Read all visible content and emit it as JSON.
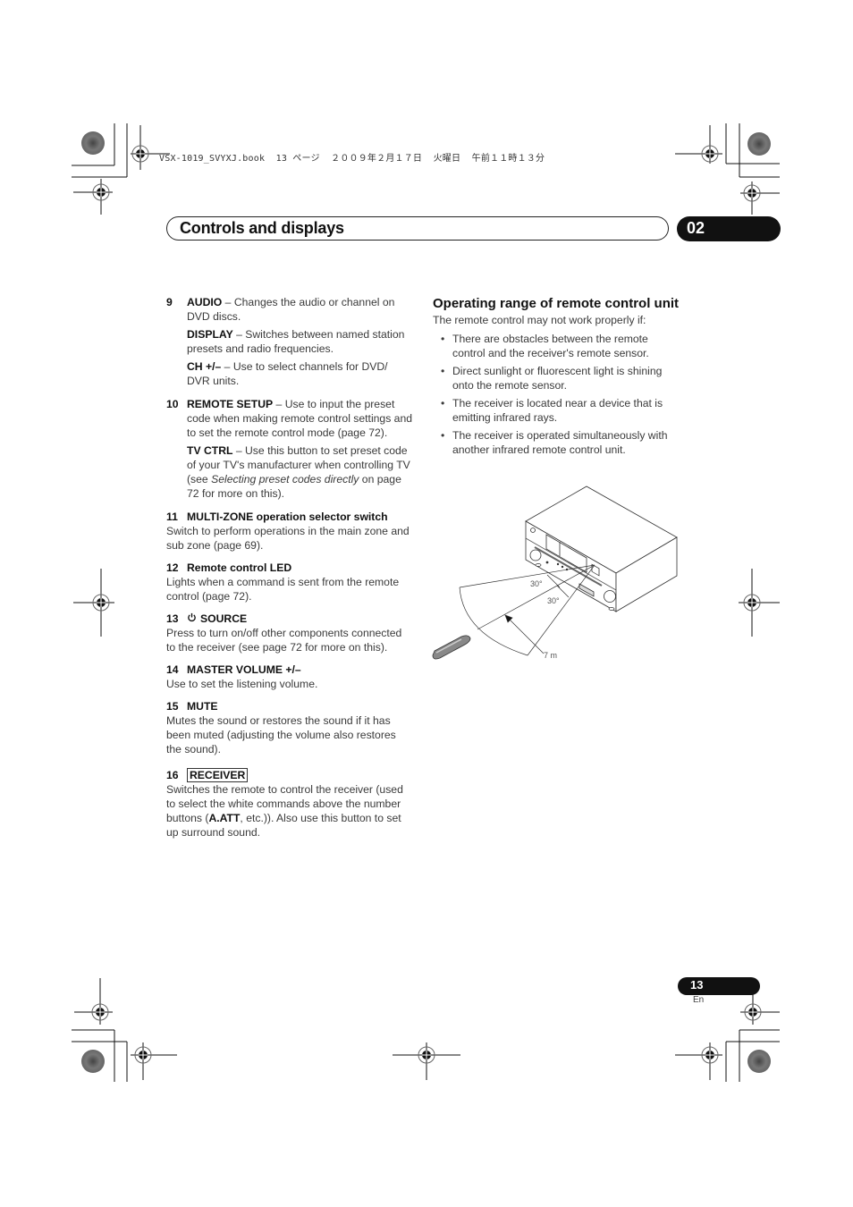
{
  "print_header": "VSX-1019_SVYXJ.book  13 ページ  ２００９年２月１７日  火曜日  午前１１時１３分",
  "chapter": {
    "title": "Controls and displays",
    "number": "02"
  },
  "left_column": {
    "items": [
      {
        "num": "9",
        "entries": [
          {
            "term": "AUDIO",
            "text": " – Changes the audio or channel on DVD discs."
          },
          {
            "term": "DISPLAY",
            "text": " – Switches between named station presets and radio frequencies."
          },
          {
            "term": "CH +/–",
            "text": " – Use to select channels for DVD/ DVR units."
          }
        ]
      },
      {
        "num": "10",
        "entries": [
          {
            "term": "REMOTE SETUP",
            "text": " – Use to input the preset code when making remote control settings and to set the remote control mode (page 72)."
          },
          {
            "term": "TV CTRL",
            "text_before": " – Use this button to set preset code of your TV's manufacturer when controlling TV (see ",
            "italic": "Selecting preset codes directly",
            "text_after": " on page 72 for more on this)."
          }
        ]
      }
    ],
    "sections": [
      {
        "num": "11",
        "title": "MULTI-ZONE operation selector switch",
        "body": "Switch to perform operations in the main zone and sub zone (page 69)."
      },
      {
        "num": "12",
        "title": "Remote control LED",
        "body": "Lights when a command is sent from the remote control (page 72)."
      },
      {
        "num": "13",
        "icon": "power-icon",
        "title": "SOURCE",
        "body": "Press to turn on/off other components connected to the receiver (see page 72 for more on this)."
      },
      {
        "num": "14",
        "title": "MASTER VOLUME +/–",
        "body": "Use to set the listening volume."
      },
      {
        "num": "15",
        "title": "MUTE",
        "body": "Mutes the sound or restores the sound if it has been muted (adjusting the volume also restores the sound)."
      },
      {
        "num": "16",
        "title": "RECEIVER",
        "body_before": "Switches the remote to control the receiver (used to select the white commands above the number buttons (",
        "body_bold": "A.ATT",
        "body_after": ", etc.)). Also use this button to set up surround sound."
      }
    ]
  },
  "right_column": {
    "heading": "Operating range of remote control unit",
    "intro": "The remote control may not work properly if:",
    "bullets": [
      "There are obstacles between the remote control and the receiver's remote sensor.",
      "Direct sunlight or fluorescent light is shining onto the remote sensor.",
      "The receiver is located near a device that is emitting infrared rays.",
      "The receiver is operated simultaneously with another infrared remote control unit."
    ],
    "diagram": {
      "angle_upper": "30°",
      "angle_lower": "30°",
      "distance": "7 m"
    }
  },
  "footer": {
    "page_number": "13",
    "language": "En"
  }
}
